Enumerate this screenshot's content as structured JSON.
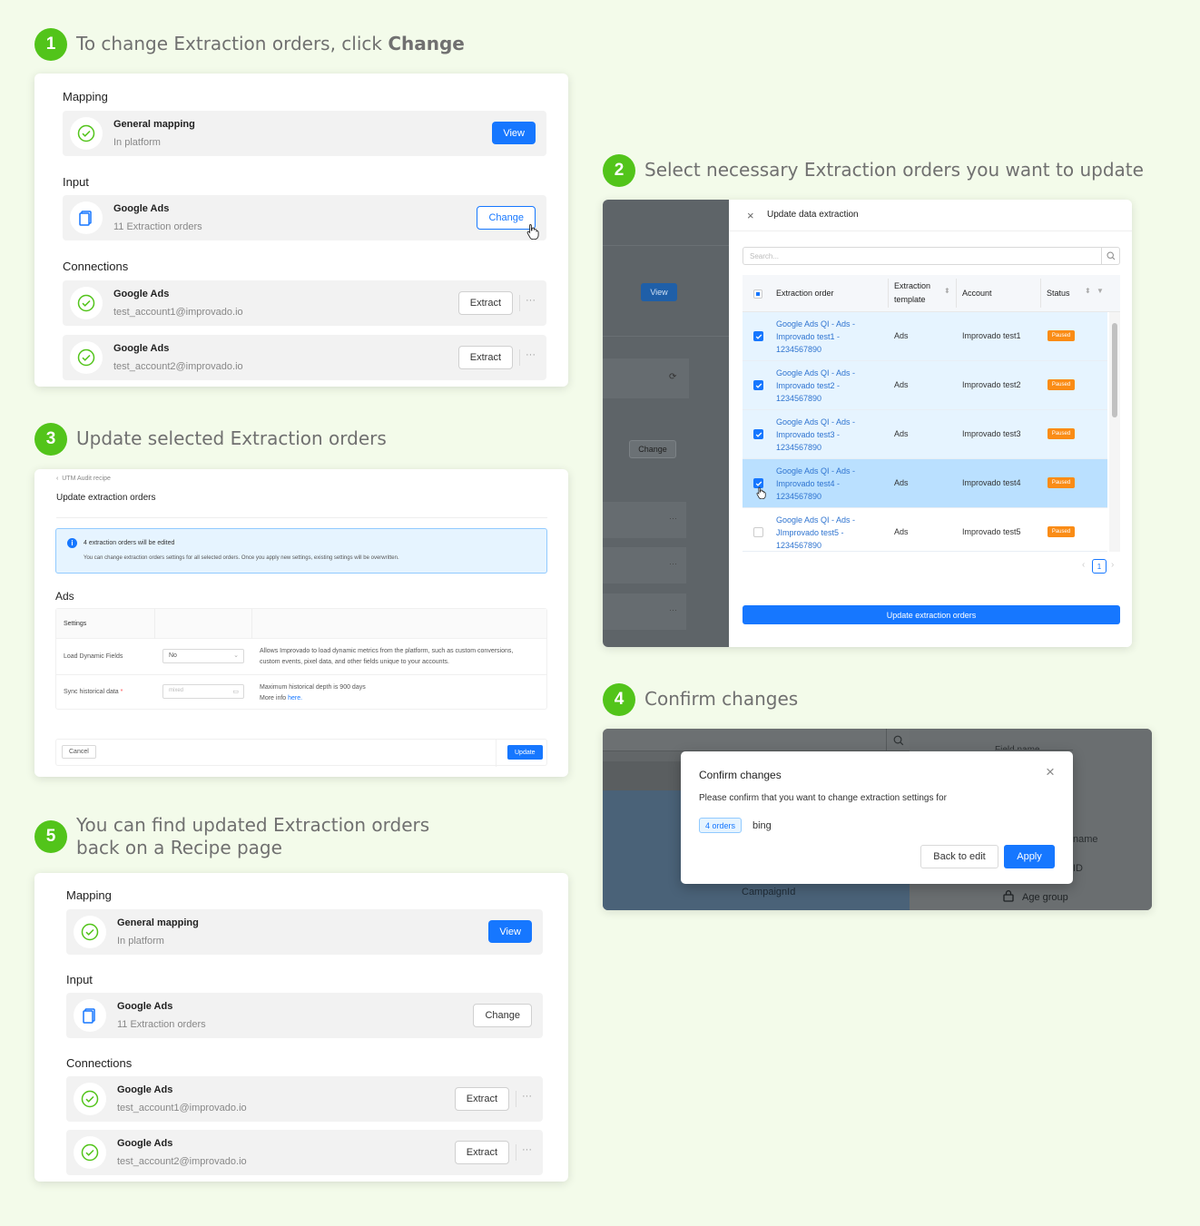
{
  "steps": {
    "s1": {
      "num": "1",
      "title": "To change Extraction orders, click ",
      "title_bold": "Change"
    },
    "s2": {
      "num": "2",
      "title": "Select necessary Extraction orders you want to update"
    },
    "s3": {
      "num": "3",
      "title": "Update selected Extraction orders"
    },
    "s4": {
      "num": "4",
      "title": "Confirm changes"
    },
    "s5": {
      "num": "5",
      "title_line1": "You can find updated Extraction orders",
      "title_line2": "back on a Recipe page"
    }
  },
  "recipe": {
    "mapping_label": "Mapping",
    "mapping_name": "General mapping",
    "mapping_sub": "In platform",
    "view_label": "View",
    "input_label": "Input",
    "input_name": "Google Ads",
    "input_sub": "11 Extraction orders",
    "change_label": "Change",
    "connections_label": "Connections",
    "connections": [
      {
        "name": "Google Ads",
        "account": "test_account1@improvado.io"
      },
      {
        "name": "Google Ads",
        "account": "test_account2@improvado.io"
      }
    ],
    "extract_label": "Extract",
    "more": "···"
  },
  "update_modal": {
    "bg_view": "View",
    "bg_change": "Change",
    "title": "Update data extraction",
    "search_placeholder": "Search...",
    "columns": {
      "order": "Extraction order",
      "template_l1": "Extraction",
      "template_l2": "template",
      "account": "Account",
      "status": "Status"
    },
    "rows": [
      {
        "l1": "Google Ads QI - Ads -",
        "l2": "Improvado test1 -",
        "l3": "1234567890",
        "template": "Ads",
        "account": "Improvado test1",
        "status": "Paused",
        "checked": true
      },
      {
        "l1": "Google Ads QI - Ads -",
        "l2": "Improvado test2 -",
        "l3": "1234567890",
        "template": "Ads",
        "account": "Improvado test2",
        "status": "Paused",
        "checked": true
      },
      {
        "l1": "Google Ads QI - Ads -",
        "l2": "Improvado test3 -",
        "l3": "1234567890",
        "template": "Ads",
        "account": "Improvado test3",
        "status": "Paused",
        "checked": true
      },
      {
        "l1": "Google Ads QI - Ads -",
        "l2": "Improvado test4 -",
        "l3": "1234567890",
        "template": "Ads",
        "account": "Improvado test4",
        "status": "Paused",
        "checked": true
      },
      {
        "l1": "Google Ads QI - Ads -",
        "l2": "JImprovado test5 -",
        "l3": "1234567890",
        "template": "Ads",
        "account": "Improvado test5",
        "status": "Paused",
        "checked": false
      }
    ],
    "page": "1",
    "submit_label": "Update extraction orders"
  },
  "update_page": {
    "breadcrumb": "UTM Audit recipe",
    "title": "Update extraction orders",
    "info_title": "4 extraction orders will be edited",
    "info_body": "You can change extraction orders settings for all selected orders. Once you apply new settings, existing settings will be overwritten.",
    "section": "Ads",
    "settings_header": "Settings",
    "s1_label": "Load Dynamic Fields",
    "s1_value": "No",
    "s1_desc_l1": "Allows Improvado to load dynamic metrics from the platform, such as custom conversions,",
    "s1_desc_l2": "custom events, pixel data, and other fields unique to your accounts.",
    "s2_label": "Sync historical data",
    "s2_req": "*",
    "s2_placeholder": "mixed",
    "s2_desc_l1": "Maximum historical depth is 900 days",
    "s2_desc_l2": "More info ",
    "s2_link": "here.",
    "cancel": "Cancel",
    "update": "Update"
  },
  "confirm": {
    "bg_field_name": "Field name",
    "bg_name": "name",
    "bg_id": "ID",
    "bg_campaign": "CampaignId",
    "bg_age": "Age group",
    "title": "Confirm changes",
    "body": "Please confirm that you want to change extraction settings for",
    "tag": "4 orders",
    "target": "bing",
    "back": "Back to edit",
    "apply": "Apply"
  },
  "colors": {
    "green": "#52c41a",
    "blue": "#1677ff",
    "orange": "#fa8c16",
    "bg": "#f3fbea"
  }
}
